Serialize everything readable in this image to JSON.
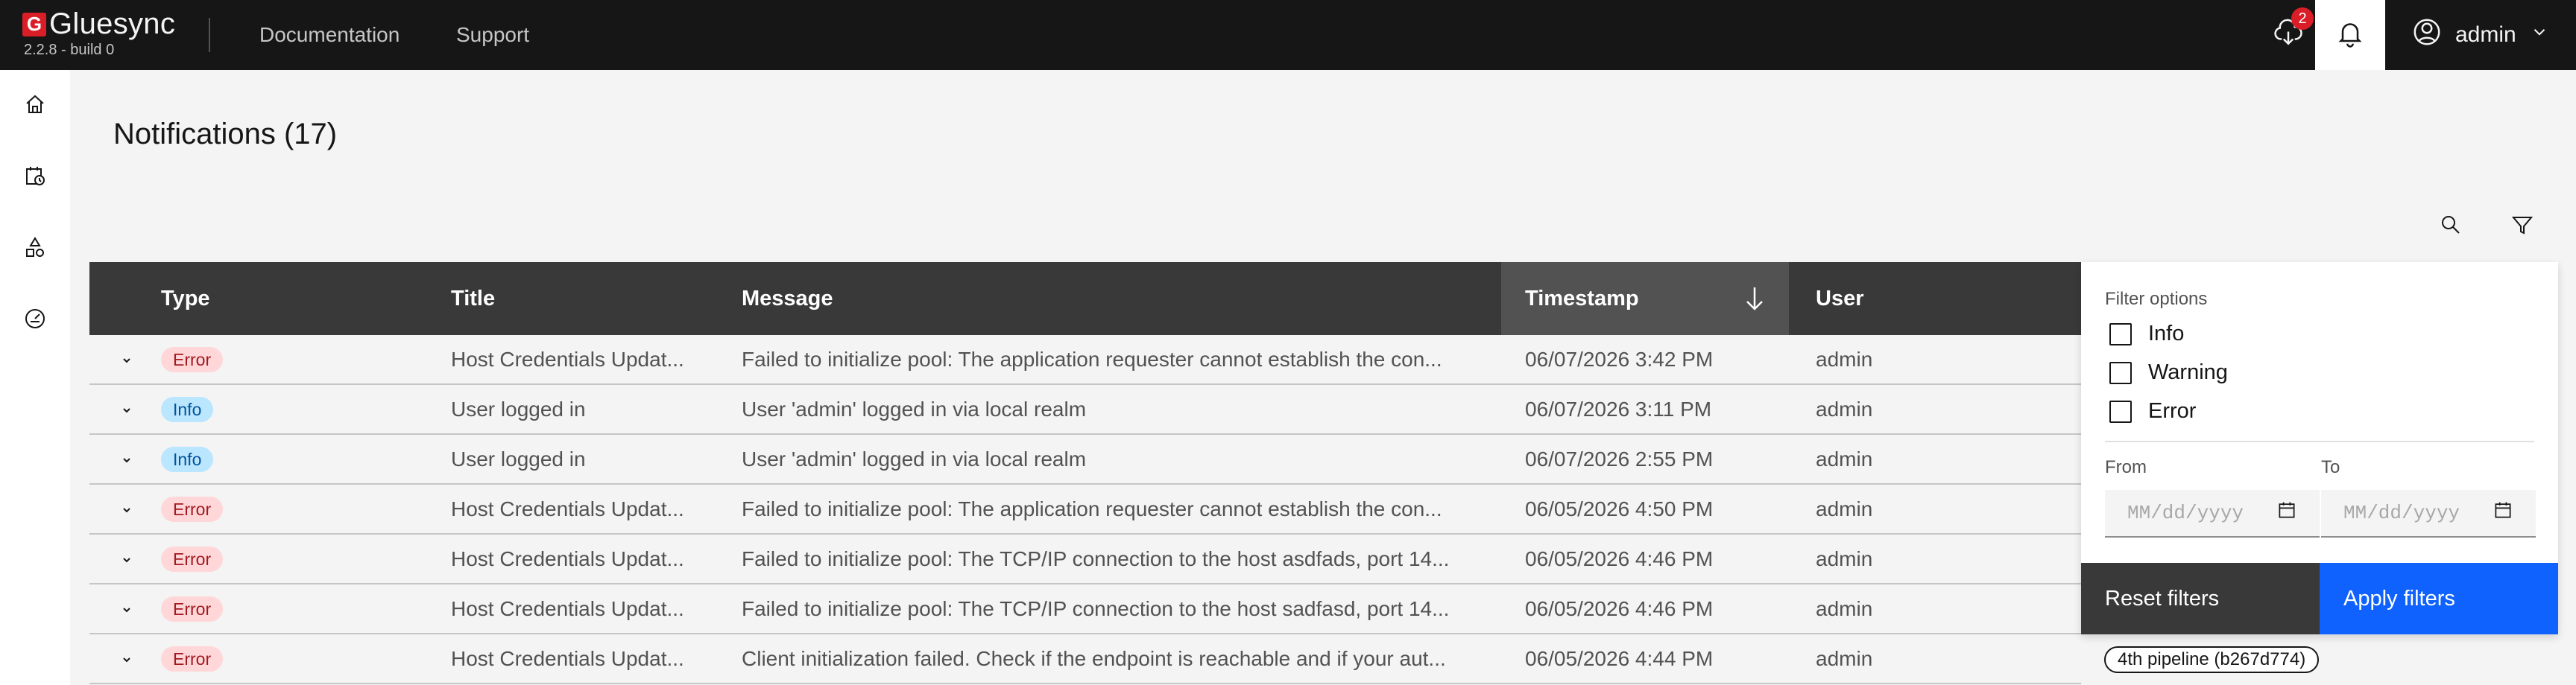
{
  "app": {
    "logo_letter": "G",
    "name": "Gluesync",
    "version": "2.2.8 - build 0"
  },
  "nav": {
    "documentation": "Documentation",
    "support": "Support"
  },
  "header": {
    "download_badge_count": "2",
    "user_name": "admin"
  },
  "sidebar": {
    "items": [
      {
        "icon": "home-icon"
      },
      {
        "icon": "calendar-clock-icon"
      },
      {
        "icon": "shapes-icon"
      },
      {
        "icon": "dashboard-gauge-icon"
      }
    ]
  },
  "page": {
    "title": "Notifications (17)"
  },
  "table": {
    "columns": {
      "type": "Type",
      "title": "Title",
      "message": "Message",
      "timestamp": "Timestamp",
      "user": "User"
    },
    "sort": {
      "column": "timestamp",
      "direction": "descending"
    },
    "rows": [
      {
        "type": "Error",
        "title": "Host Credentials Updat...",
        "message": "Failed to initialize pool: The application requester cannot establish the con...",
        "timestamp": "06/07/2026 3:42 PM",
        "user": "admin"
      },
      {
        "type": "Info",
        "title": "User logged in",
        "message": "User 'admin' logged in via local realm",
        "timestamp": "06/07/2026 3:11 PM",
        "user": "admin"
      },
      {
        "type": "Info",
        "title": "User logged in",
        "message": "User 'admin' logged in via local realm",
        "timestamp": "06/07/2026 2:55 PM",
        "user": "admin"
      },
      {
        "type": "Error",
        "title": "Host Credentials Updat...",
        "message": "Failed to initialize pool: The application requester cannot establish the con...",
        "timestamp": "06/05/2026 4:50 PM",
        "user": "admin"
      },
      {
        "type": "Error",
        "title": "Host Credentials Updat...",
        "message": "Failed to initialize pool: The TCP/IP connection to the host asdfads, port 14...",
        "timestamp": "06/05/2026 4:46 PM",
        "user": "admin"
      },
      {
        "type": "Error",
        "title": "Host Credentials Updat...",
        "message": "Failed to initialize pool: The TCP/IP connection to the host sadfasd, port 14...",
        "timestamp": "06/05/2026 4:46 PM",
        "user": "admin"
      },
      {
        "type": "Error",
        "title": "Host Credentials Updat...",
        "message": "Client initialization failed. Check if the endpoint is reachable and if your aut...",
        "timestamp": "06/05/2026 4:44 PM",
        "user": "admin"
      }
    ],
    "last_row_pipeline": "4th pipeline (b267d774)"
  },
  "filter": {
    "heading": "Filter options",
    "options": [
      "Info",
      "Warning",
      "Error"
    ],
    "from_label": "From",
    "to_label": "To",
    "from_placeholder": "MM/dd/yyyy",
    "to_placeholder": "MM/dd/yyyy",
    "reset_label": "Reset filters",
    "apply_label": "Apply filters"
  },
  "colors": {
    "topbar": "#161616",
    "error_tag_bg": "#ffd7d9",
    "info_tag_bg": "#bae6ff",
    "apply_button": "#0f62fe",
    "badge": "#da1e28"
  }
}
